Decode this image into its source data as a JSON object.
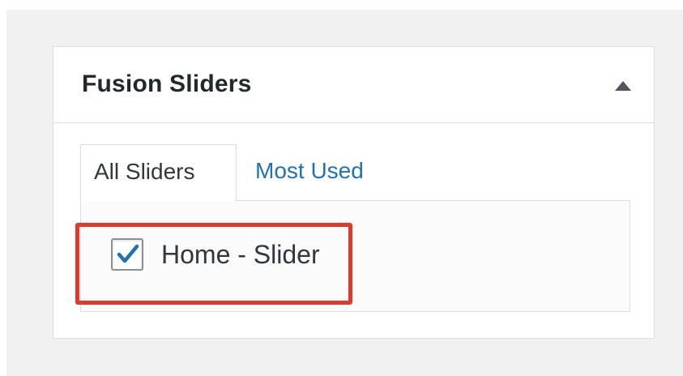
{
  "metabox": {
    "title": "Fusion Sliders",
    "toggle_icon": "triangle-up-icon"
  },
  "tabs": [
    {
      "label": "All Sliders",
      "active": true
    },
    {
      "label": "Most Used",
      "active": false
    }
  ],
  "sliders": [
    {
      "label": "Home - Slider",
      "checked": true
    }
  ],
  "colors": {
    "background": "#f1f1f1",
    "link": "#2271b1",
    "check": "#2271b1",
    "highlight": "#e03a2e",
    "title": "#23282d"
  }
}
